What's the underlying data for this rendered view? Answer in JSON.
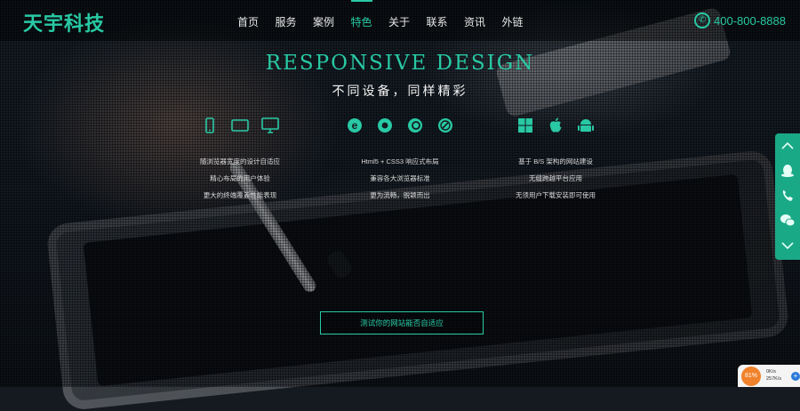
{
  "header": {
    "logo": "天宇科技",
    "nav": [
      "首页",
      "服务",
      "案例",
      "特色",
      "关于",
      "联系",
      "资讯",
      "外链"
    ],
    "active_nav": "特色",
    "phone": "400-800-8888"
  },
  "hero": {
    "title": "RESPONSIVE DESIGN",
    "subtitle": "不同设备，同样精彩"
  },
  "features": [
    {
      "icons": [
        "phone-device-icon",
        "tablet-device-icon",
        "monitor-device-icon"
      ],
      "lines": [
        "随浏览器宽度的设计自适应",
        "精心布局的用户体验",
        "更大的终端覆盖性能表现"
      ]
    },
    {
      "icons": [
        "ie-browser-icon",
        "chrome-browser-icon",
        "firefox-browser-icon",
        "safari-browser-icon"
      ],
      "lines": [
        "Html5 + CSS3 响应式布局",
        "兼容各大浏览器标准",
        "更为流畅，脱颖而出"
      ]
    },
    {
      "icons": [
        "windows-icon",
        "apple-icon",
        "android-icon"
      ],
      "lines": [
        "基于 B/S 架构的网站建设",
        "无缝跨越平台应用",
        "无须用户下载安装即可使用"
      ]
    }
  ],
  "cta": {
    "label": "测试你的网站能否自适应"
  },
  "side_panel": {
    "buttons": [
      "chevron-up-icon",
      "qq-icon",
      "phone-call-icon",
      "wechat-icon",
      "chevron-down-icon"
    ]
  },
  "widget": {
    "percent": "81%",
    "stat_top": "0K/s",
    "stat_bottom": "257K/s"
  },
  "colors": {
    "accent": "#28c9a4",
    "side_panel": "#1aa986",
    "widget_badge": "#f0822b"
  }
}
